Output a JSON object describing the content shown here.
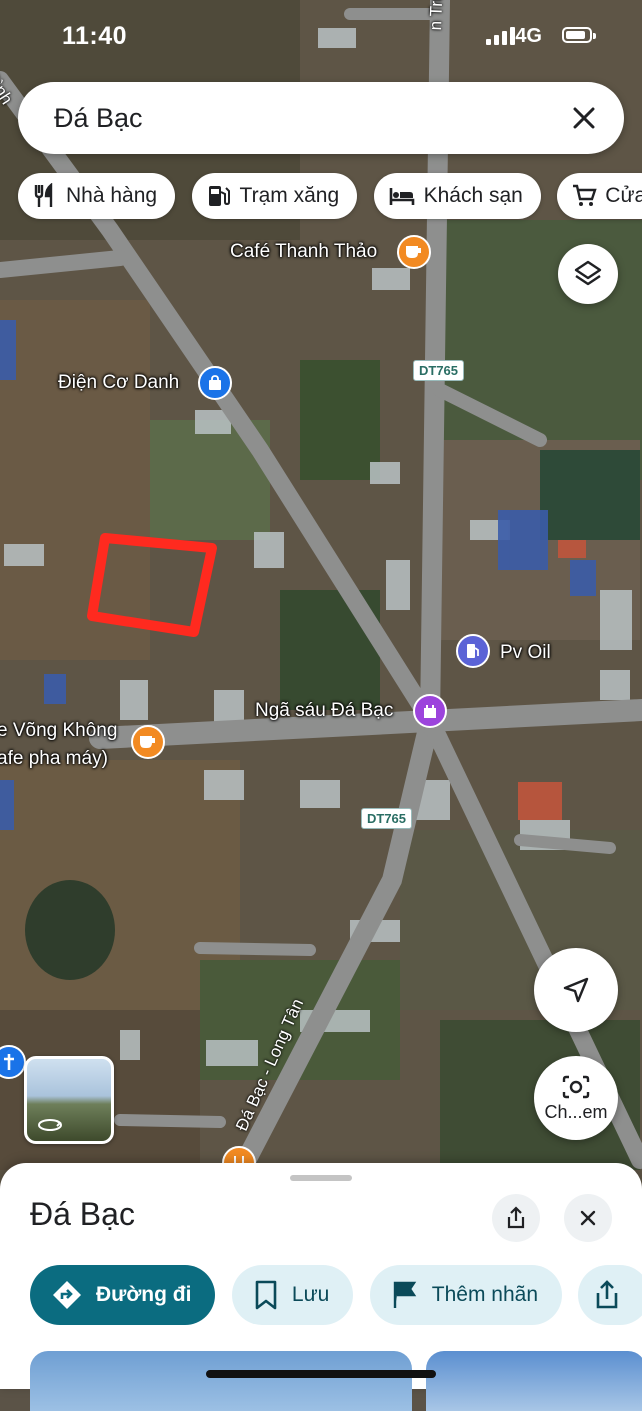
{
  "status_bar": {
    "time": "11:40",
    "network": "4G"
  },
  "search": {
    "query": "Đá Bạc"
  },
  "chips": [
    {
      "label": "Nhà hàng",
      "icon": "restaurant-icon"
    },
    {
      "label": "Trạm xăng",
      "icon": "gas-station-icon"
    },
    {
      "label": "Khách sạn",
      "icon": "hotel-icon"
    },
    {
      "label": "Cửa",
      "icon": "shopping-cart-icon"
    }
  ],
  "map_labels": {
    "cafe_thanh_thao": "Café Thanh Thảo",
    "dien_co_danh": "Điện Cơ Danh",
    "pv_oil": "Pv Oil",
    "nga_sau": "Ngã sáu Đá Bạc",
    "cafe_vong_1": "e Võng Không",
    "cafe_vong_2": "afe pha máy)",
    "road_top": "n Trung -",
    "road_topleft": "Bình",
    "road_bottom": "Đá Bạc - Long Tân",
    "shield_1": "DT765",
    "shield_2": "DT765"
  },
  "camera_fab": {
    "label": "Ch...em"
  },
  "place_sheet": {
    "title": "Đá Bạc",
    "actions": [
      {
        "label": "Đường đi",
        "icon": "directions-icon"
      },
      {
        "label": "Lưu",
        "icon": "bookmark-icon"
      },
      {
        "label": "Thêm nhãn",
        "icon": "flag-icon"
      }
    ]
  },
  "colors": {
    "accent": "#0b6c80",
    "action_bg": "#dff0f5",
    "highlight_outline": "#ff2a1f",
    "cafe_pin": "#f28a22",
    "place_pin": "#1a73e8",
    "landmark_pin": "#9c44dc",
    "fuel_pin": "#5b63d6"
  }
}
